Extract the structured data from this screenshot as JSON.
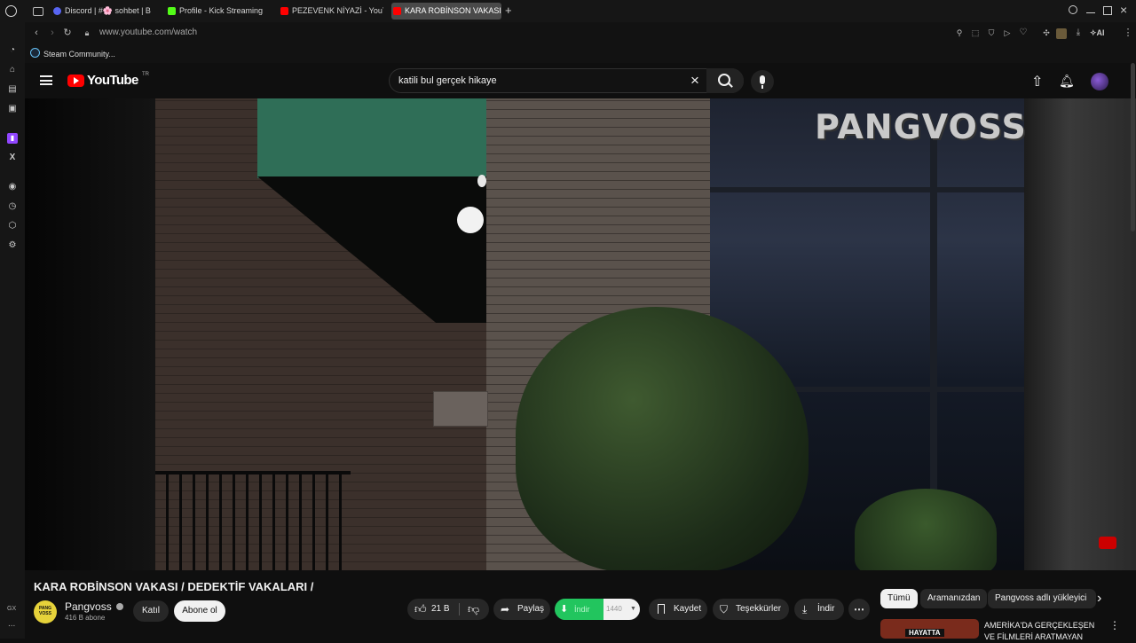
{
  "browser": {
    "tabs": [
      {
        "label": "Discord | #🌸 sohbet | B",
        "favicon": "discord-icon"
      },
      {
        "label": "Profile - Kick Streaming",
        "favicon": "kick-icon"
      },
      {
        "label": "PEZEVENK NİYAZİ - YouTu",
        "favicon": "youtube-icon"
      },
      {
        "label": "KARA ROBİNSON VAKASI",
        "favicon": "youtube-icon"
      }
    ],
    "url": "www.youtube.com/watch",
    "bookmark": "Steam Community...",
    "ai_label": "AI",
    "gx_label": "GX",
    "more_label": "..."
  },
  "youtube": {
    "logo_text": "YouTube",
    "region": "TR",
    "search_value": "katili bul gerçek hikaye",
    "video": {
      "watermark": "PANGVOSS",
      "title": "KARA ROBİNSON VAKASI / DEDEKTİF VAKALARI /"
    },
    "channel": {
      "name": "Pangvoss",
      "subscribers": "416 B abone",
      "avatar_text": "PANG VOSS",
      "join_label": "Katıl",
      "subscribe_label": "Abone ol"
    },
    "actions": {
      "likes": "21 B",
      "share": "Paylaş",
      "download_ext": "İndir",
      "quality": "1440",
      "save": "Kaydet",
      "thanks": "Teşekkürler",
      "download": "İndir"
    },
    "chips": [
      "Tümü",
      "Aramanızdan",
      "Pangvoss adlı yükleyici"
    ],
    "recommended": {
      "title": "AMERİKA'DA GERÇEKLEŞEN VE FİLMLERİ ARATMAYAN",
      "thumb_text": "HAYATTA"
    }
  },
  "colors": {
    "youtube_red": "#ff0000",
    "download_green": "#22c55e",
    "twitch_purple": "#9146ff"
  }
}
